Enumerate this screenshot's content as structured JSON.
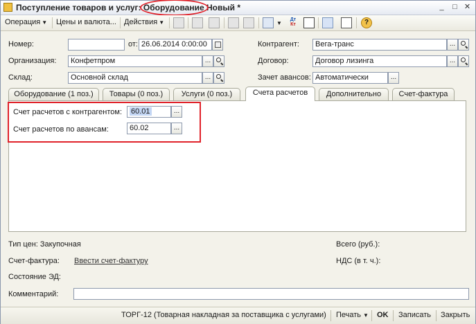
{
  "window": {
    "title_prefix": "Поступление товаров и услуг: ",
    "title_highlight": "Оборудование",
    "title_suffix": " Новый *",
    "minimize": "_",
    "maximize": "□",
    "close": "✕"
  },
  "toolbar": {
    "operation": "Операция",
    "prices": "Цены и валюта...",
    "actions": "Действия",
    "dtkt_top": "Дт",
    "dtkt_bottom": "Кт",
    "help": "?"
  },
  "form": {
    "number_label": "Номер:",
    "number_value": "",
    "from_label": "от:",
    "date_value": "26.06.2014  0:00:00",
    "org_label": "Организация:",
    "org_value": "Конфетпром",
    "warehouse_label": "Склад:",
    "warehouse_value": "Основной склад",
    "contractor_label": "Контрагент:",
    "contractor_value": "Вега-транс",
    "contract_label": "Договор:",
    "contract_value": "Договор лизинга",
    "advance_label": "Зачет авансов:",
    "advance_value": "Автоматически",
    "ellipsis": "..."
  },
  "tabs": [
    {
      "label": "Оборудование (1 поз.)"
    },
    {
      "label": "Товары (0 поз.)"
    },
    {
      "label": "Услуги (0 поз.)"
    },
    {
      "label": "Счета расчетов"
    },
    {
      "label": "Дополнительно"
    },
    {
      "label": "Счет-фактура"
    }
  ],
  "accounts": {
    "contractor_label": "Счет расчетов с контрагентом:",
    "contractor_value": "60.01",
    "advance_label": "Счет расчетов по авансам:",
    "advance_value": "60.02"
  },
  "footer": {
    "price_type": "Тип цен: Закупочная",
    "total_label": "Всего (руб.):",
    "invoice_label": "Счет-фактура:",
    "invoice_link": "Ввести счет-фактуру",
    "vat_label": "НДС (в т. ч.):",
    "ed_state_label": "Состояние ЭД:",
    "comment_label": "Комментарий:",
    "comment_value": ""
  },
  "bottombar": {
    "torg": "ТОРГ-12 (Товарная накладная за поставщика с услугами)",
    "print": "Печать",
    "ok": "OK",
    "save": "Записать",
    "close": "Закрыть"
  },
  "colors": {
    "annotation_red": "#e0222a",
    "selection_blue": "#c3d6f4"
  }
}
